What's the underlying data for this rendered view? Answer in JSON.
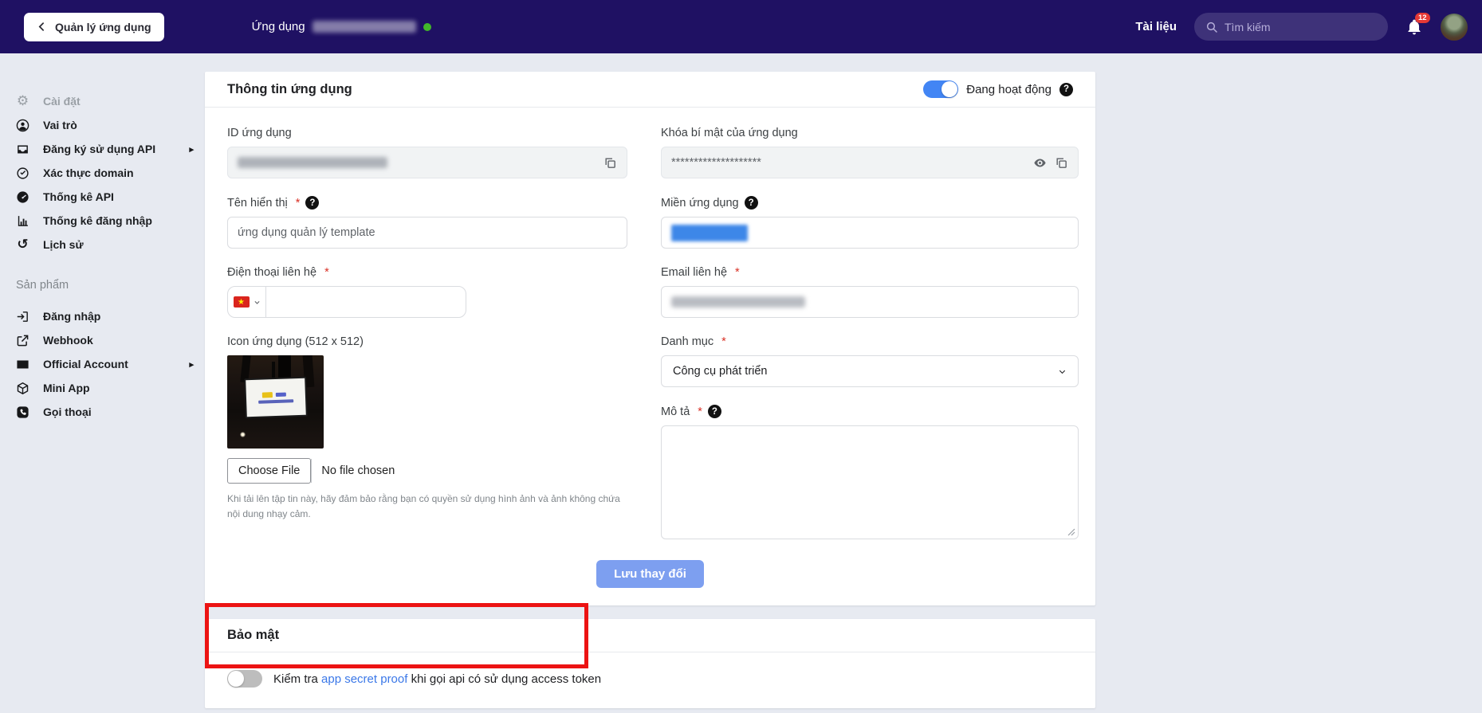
{
  "topbar": {
    "back_button_label": "Quản lý ứng dụng",
    "app_context_label": "Ứng dụng",
    "docs_label": "Tài liệu",
    "search_placeholder": "Tìm kiếm",
    "notification_count": "12"
  },
  "sidebar": {
    "settings_items": [
      {
        "label": "Cài đặt",
        "icon": "gear-icon",
        "active": true
      },
      {
        "label": "Vai trò",
        "icon": "user-icon"
      },
      {
        "label": "Đăng ký sử dụng API",
        "icon": "inbox-icon",
        "has_submenu": true
      },
      {
        "label": "Xác thực domain",
        "icon": "check-circle-icon"
      },
      {
        "label": "Thống kê API",
        "icon": "gauge-icon"
      },
      {
        "label": "Thống kê đăng nhập",
        "icon": "bar-chart-icon"
      },
      {
        "label": "Lịch sử",
        "icon": "history-icon"
      }
    ],
    "section_title": "Sản phẩm",
    "product_items": [
      {
        "label": "Đăng nhập",
        "icon": "login-icon"
      },
      {
        "label": "Webhook",
        "icon": "external-link-icon"
      },
      {
        "label": "Official Account",
        "icon": "contact-card-icon",
        "has_submenu": true
      },
      {
        "label": "Mini App",
        "icon": "cube-icon"
      },
      {
        "label": "Gọi thoại",
        "icon": "phone-icon"
      }
    ]
  },
  "app_info": {
    "title": "Thông tin ứng dụng",
    "status_toggle": {
      "label": "Đang hoạt động",
      "state": "on"
    },
    "fields": {
      "app_id": {
        "label": "ID ứng dụng",
        "value_redacted": true
      },
      "secret_key": {
        "label": "Khóa bí mật của ứng dụng",
        "value": "********************"
      },
      "display_name": {
        "label": "Tên hiển thị",
        "required": true,
        "value": "ứng dụng quản lý template"
      },
      "app_domain": {
        "label": "Miền ứng dụng",
        "value_redacted": true
      },
      "contact_phone": {
        "label": "Điện thoại liên hệ",
        "required": true,
        "country": "VN",
        "value_redacted": true
      },
      "contact_email": {
        "label": "Email liên hệ",
        "required": true,
        "value_redacted": true
      },
      "app_icon": {
        "label": "Icon ứng dụng (512 x 512)",
        "file_button": "Choose File",
        "file_status": "No file chosen",
        "note": "Khi tải lên tập tin này, hãy đảm bảo rằng bạn có quyền sử dụng hình ảnh và ảnh không chứa nội dung nhạy cảm."
      },
      "category": {
        "label": "Danh mục",
        "required": true,
        "value": "Công cụ phát triển"
      },
      "description": {
        "label": "Mô tả",
        "required": true,
        "value_redacted": true
      }
    },
    "save_button_label": "Lưu thay đổi"
  },
  "security": {
    "title": "Bảo mật",
    "proof_toggle": {
      "state": "off",
      "text_before": "Kiểm tra ",
      "link_text": "app secret proof",
      "text_after": " khi gọi api có sử dụng access token"
    }
  },
  "glyphs": {
    "question": "?",
    "submenu_arrow": "▸",
    "required_marker": "*",
    "gear": "⚙",
    "history": "↺"
  },
  "colors": {
    "topbar_bg": "#1f1163",
    "accent_blue": "#4285f4",
    "save_button": "#7d9ff0",
    "link_blue": "#3b78e8",
    "annotation_red": "#ec1313",
    "active_dot_green": "#42b72a",
    "badge_red": "#e53935"
  }
}
